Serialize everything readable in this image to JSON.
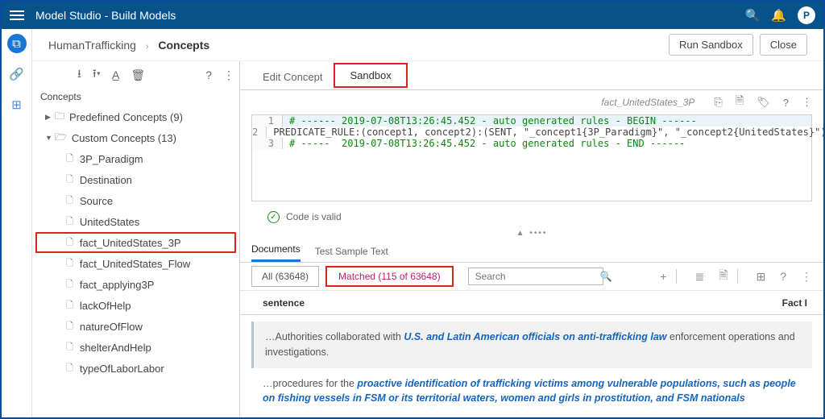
{
  "topbar": {
    "title": "Model Studio - Build Models",
    "avatar_initial": "P"
  },
  "breadcrumb": {
    "project": "HumanTrafficking",
    "page": "Concepts"
  },
  "action_buttons": {
    "run": "Run Sandbox",
    "close": "Close"
  },
  "leftpanel": {
    "heading": "Concepts",
    "predefined_label": "Predefined Concepts (9)",
    "custom_label": "Custom Concepts (13)",
    "items": [
      "3P_Paradigm",
      "Destination",
      "Source",
      "UnitedStates",
      "fact_UnitedStates_3P",
      "fact_UnitedStates_Flow",
      "fact_applying3P",
      "lackOfHelp",
      "natureOfFlow",
      "shelterAndHelp",
      "typeOfLaborLabor"
    ],
    "selected_index": 4
  },
  "tabs_top": {
    "edit": "Edit Concept",
    "sandbox": "Sandbox"
  },
  "code": {
    "filename": "fact_UnitedStates_3P",
    "lines": [
      "# ------ 2019-07-08T13:26:45.452 - auto generated rules - BEGIN ------",
      "PREDICATE_RULE:(concept1, concept2):(SENT, \"_concept1{3P_Paradigm}\", \"_concept2{UnitedStates}\")",
      "# -----  2019-07-08T13:26:45.452 - auto generated rules - END ------"
    ],
    "valid_msg": "Code is valid"
  },
  "tabs_bottom": {
    "docs": "Documents",
    "sample": "Test Sample Text"
  },
  "filters": {
    "all_label": "All (63648)",
    "matched_label": "Matched (115 of 63648)",
    "search_placeholder": "Search"
  },
  "results_header": {
    "col1": "sentence",
    "col2": "Fact I"
  },
  "results": [
    {
      "pre": "…Authorities collaborated with ",
      "match": "U.S. and Latin American officials on anti-trafficking law",
      "post": " enforcement operations and investigations."
    },
    {
      "pre": "…procedures for the ",
      "match": "proactive identification of trafficking victims among vulnerable populations, such as people on fishing vessels in FSM or its territorial waters, women and girls in prostitution, and FSM nationals",
      "post": ""
    }
  ]
}
